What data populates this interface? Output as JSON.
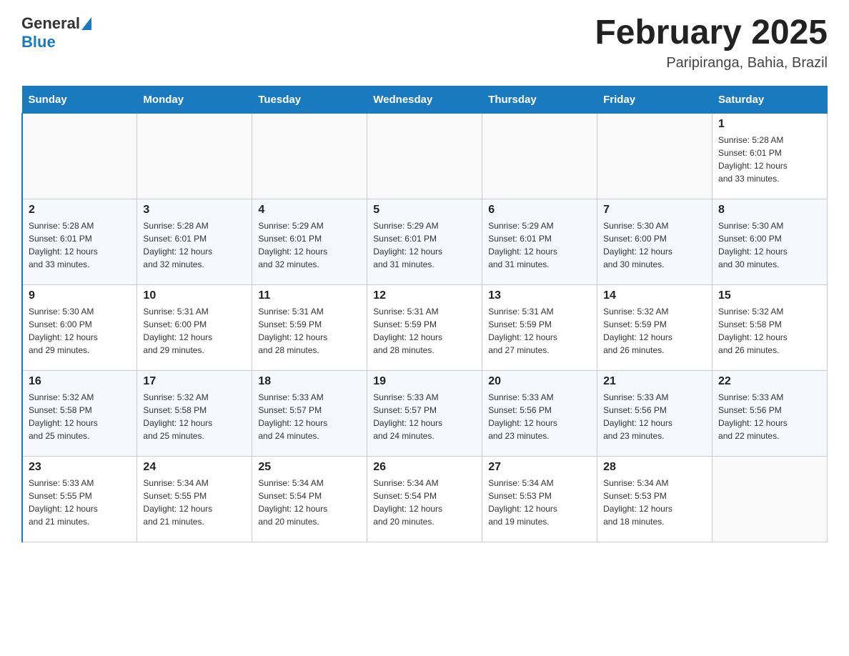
{
  "header": {
    "logo_general": "General",
    "logo_blue": "Blue",
    "month_title": "February 2025",
    "location": "Paripiranga, Bahia, Brazil"
  },
  "weekdays": [
    "Sunday",
    "Monday",
    "Tuesday",
    "Wednesday",
    "Thursday",
    "Friday",
    "Saturday"
  ],
  "weeks": [
    [
      {
        "day": "",
        "info": ""
      },
      {
        "day": "",
        "info": ""
      },
      {
        "day": "",
        "info": ""
      },
      {
        "day": "",
        "info": ""
      },
      {
        "day": "",
        "info": ""
      },
      {
        "day": "",
        "info": ""
      },
      {
        "day": "1",
        "info": "Sunrise: 5:28 AM\nSunset: 6:01 PM\nDaylight: 12 hours\nand 33 minutes."
      }
    ],
    [
      {
        "day": "2",
        "info": "Sunrise: 5:28 AM\nSunset: 6:01 PM\nDaylight: 12 hours\nand 33 minutes."
      },
      {
        "day": "3",
        "info": "Sunrise: 5:28 AM\nSunset: 6:01 PM\nDaylight: 12 hours\nand 32 minutes."
      },
      {
        "day": "4",
        "info": "Sunrise: 5:29 AM\nSunset: 6:01 PM\nDaylight: 12 hours\nand 32 minutes."
      },
      {
        "day": "5",
        "info": "Sunrise: 5:29 AM\nSunset: 6:01 PM\nDaylight: 12 hours\nand 31 minutes."
      },
      {
        "day": "6",
        "info": "Sunrise: 5:29 AM\nSunset: 6:01 PM\nDaylight: 12 hours\nand 31 minutes."
      },
      {
        "day": "7",
        "info": "Sunrise: 5:30 AM\nSunset: 6:00 PM\nDaylight: 12 hours\nand 30 minutes."
      },
      {
        "day": "8",
        "info": "Sunrise: 5:30 AM\nSunset: 6:00 PM\nDaylight: 12 hours\nand 30 minutes."
      }
    ],
    [
      {
        "day": "9",
        "info": "Sunrise: 5:30 AM\nSunset: 6:00 PM\nDaylight: 12 hours\nand 29 minutes."
      },
      {
        "day": "10",
        "info": "Sunrise: 5:31 AM\nSunset: 6:00 PM\nDaylight: 12 hours\nand 29 minutes."
      },
      {
        "day": "11",
        "info": "Sunrise: 5:31 AM\nSunset: 5:59 PM\nDaylight: 12 hours\nand 28 minutes."
      },
      {
        "day": "12",
        "info": "Sunrise: 5:31 AM\nSunset: 5:59 PM\nDaylight: 12 hours\nand 28 minutes."
      },
      {
        "day": "13",
        "info": "Sunrise: 5:31 AM\nSunset: 5:59 PM\nDaylight: 12 hours\nand 27 minutes."
      },
      {
        "day": "14",
        "info": "Sunrise: 5:32 AM\nSunset: 5:59 PM\nDaylight: 12 hours\nand 26 minutes."
      },
      {
        "day": "15",
        "info": "Sunrise: 5:32 AM\nSunset: 5:58 PM\nDaylight: 12 hours\nand 26 minutes."
      }
    ],
    [
      {
        "day": "16",
        "info": "Sunrise: 5:32 AM\nSunset: 5:58 PM\nDaylight: 12 hours\nand 25 minutes."
      },
      {
        "day": "17",
        "info": "Sunrise: 5:32 AM\nSunset: 5:58 PM\nDaylight: 12 hours\nand 25 minutes."
      },
      {
        "day": "18",
        "info": "Sunrise: 5:33 AM\nSunset: 5:57 PM\nDaylight: 12 hours\nand 24 minutes."
      },
      {
        "day": "19",
        "info": "Sunrise: 5:33 AM\nSunset: 5:57 PM\nDaylight: 12 hours\nand 24 minutes."
      },
      {
        "day": "20",
        "info": "Sunrise: 5:33 AM\nSunset: 5:56 PM\nDaylight: 12 hours\nand 23 minutes."
      },
      {
        "day": "21",
        "info": "Sunrise: 5:33 AM\nSunset: 5:56 PM\nDaylight: 12 hours\nand 23 minutes."
      },
      {
        "day": "22",
        "info": "Sunrise: 5:33 AM\nSunset: 5:56 PM\nDaylight: 12 hours\nand 22 minutes."
      }
    ],
    [
      {
        "day": "23",
        "info": "Sunrise: 5:33 AM\nSunset: 5:55 PM\nDaylight: 12 hours\nand 21 minutes."
      },
      {
        "day": "24",
        "info": "Sunrise: 5:34 AM\nSunset: 5:55 PM\nDaylight: 12 hours\nand 21 minutes."
      },
      {
        "day": "25",
        "info": "Sunrise: 5:34 AM\nSunset: 5:54 PM\nDaylight: 12 hours\nand 20 minutes."
      },
      {
        "day": "26",
        "info": "Sunrise: 5:34 AM\nSunset: 5:54 PM\nDaylight: 12 hours\nand 20 minutes."
      },
      {
        "day": "27",
        "info": "Sunrise: 5:34 AM\nSunset: 5:53 PM\nDaylight: 12 hours\nand 19 minutes."
      },
      {
        "day": "28",
        "info": "Sunrise: 5:34 AM\nSunset: 5:53 PM\nDaylight: 12 hours\nand 18 minutes."
      },
      {
        "day": "",
        "info": ""
      }
    ]
  ]
}
